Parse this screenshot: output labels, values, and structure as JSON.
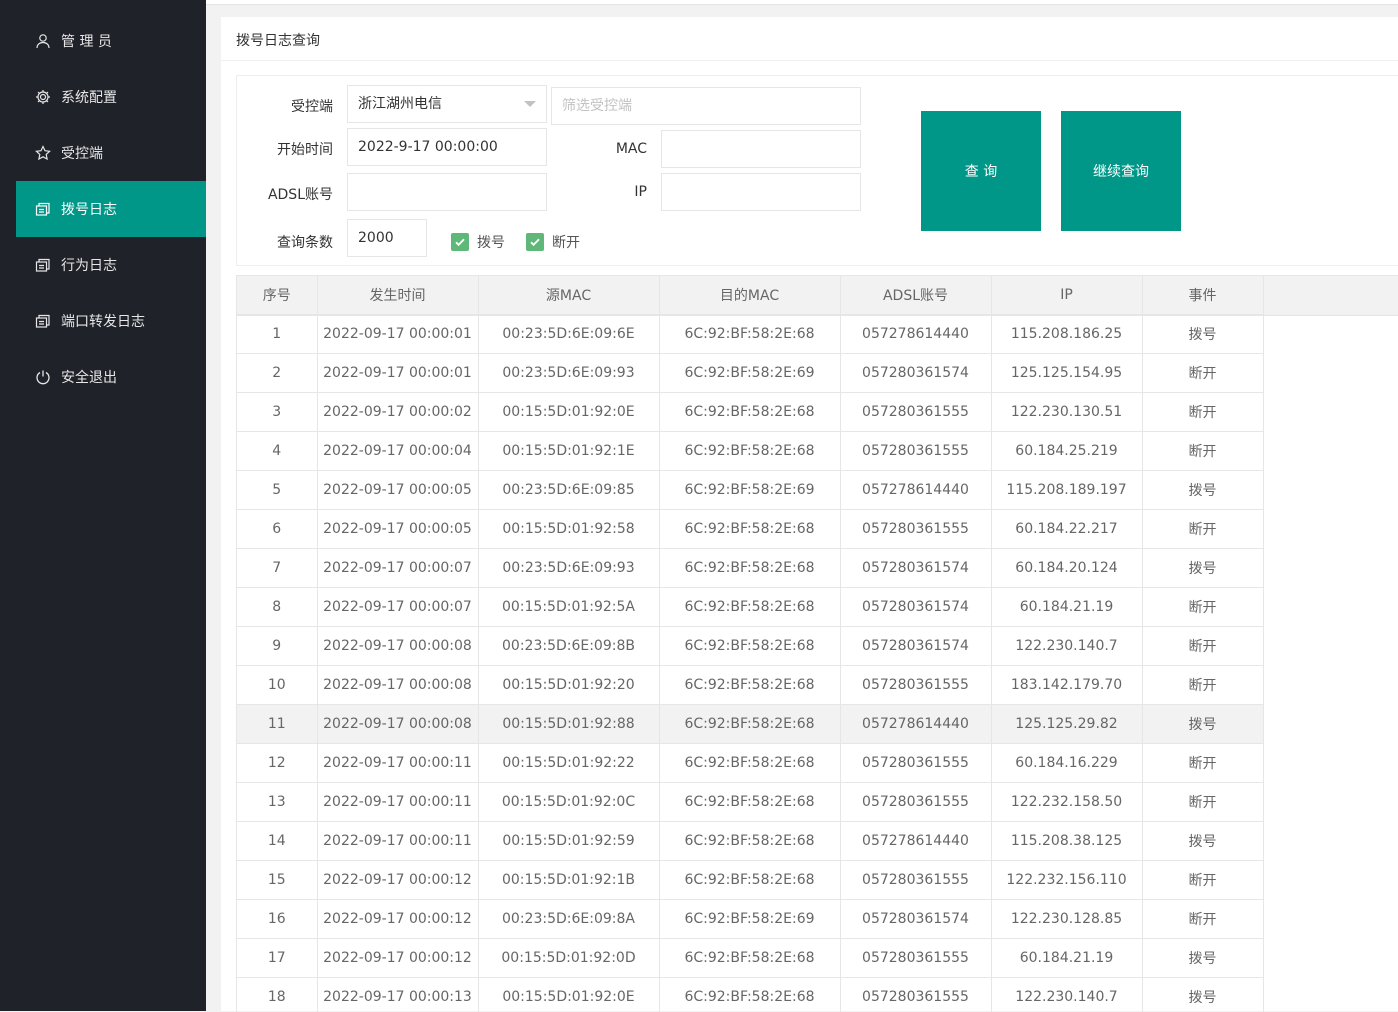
{
  "sidebar": {
    "items": [
      {
        "label": "管 理 员",
        "icon": "user-icon",
        "active": false
      },
      {
        "label": "系统配置",
        "icon": "gear-icon",
        "active": false
      },
      {
        "label": "受控端",
        "icon": "star-icon",
        "active": false
      },
      {
        "label": "拨号日志",
        "icon": "log-icon",
        "active": true
      },
      {
        "label": "行为日志",
        "icon": "log-icon",
        "active": false
      },
      {
        "label": "端口转发日志",
        "icon": "log-icon",
        "active": false
      },
      {
        "label": "安全退出",
        "icon": "power-icon",
        "active": false
      }
    ]
  },
  "panel": {
    "title": "拨号日志查询"
  },
  "form": {
    "controlled_label": "受控端",
    "controlled_value": "浙江湖州电信",
    "filter_placeholder": "筛选受控端",
    "start_label": "开始时间",
    "start_value": "2022-9-17 00:00:00",
    "mac_label": "MAC",
    "mac_value": "",
    "adsl_label": "ADSL账号",
    "adsl_value": "",
    "ip_label": "IP",
    "ip_value": "",
    "count_label": "查询条数",
    "count_value": "2000",
    "dial_label": "拨号",
    "dial_checked": true,
    "disconnect_label": "断开",
    "disconnect_checked": true,
    "query_button": "查 询",
    "continue_button": "继续查询"
  },
  "colors": {
    "accent": "#009688",
    "sidebar_bg": "#20222a",
    "checkbox": "#5fb878"
  },
  "table": {
    "headers": [
      "序号",
      "发生时间",
      "源MAC",
      "目的MAC",
      "ADSL账号",
      "IP",
      "事件"
    ],
    "highlight_row": 11,
    "rows": [
      [
        "1",
        "2022-09-17 00:00:01",
        "00:23:5D:6E:09:6E",
        "6C:92:BF:58:2E:68",
        "057278614440",
        "115.208.186.25",
        "拨号"
      ],
      [
        "2",
        "2022-09-17 00:00:01",
        "00:23:5D:6E:09:93",
        "6C:92:BF:58:2E:69",
        "057280361574",
        "125.125.154.95",
        "断开"
      ],
      [
        "3",
        "2022-09-17 00:00:02",
        "00:15:5D:01:92:0E",
        "6C:92:BF:58:2E:68",
        "057280361555",
        "122.230.130.51",
        "断开"
      ],
      [
        "4",
        "2022-09-17 00:00:04",
        "00:15:5D:01:92:1E",
        "6C:92:BF:58:2E:68",
        "057280361555",
        "60.184.25.219",
        "断开"
      ],
      [
        "5",
        "2022-09-17 00:00:05",
        "00:23:5D:6E:09:85",
        "6C:92:BF:58:2E:69",
        "057278614440",
        "115.208.189.197",
        "拨号"
      ],
      [
        "6",
        "2022-09-17 00:00:05",
        "00:15:5D:01:92:58",
        "6C:92:BF:58:2E:68",
        "057280361555",
        "60.184.22.217",
        "断开"
      ],
      [
        "7",
        "2022-09-17 00:00:07",
        "00:23:5D:6E:09:93",
        "6C:92:BF:58:2E:68",
        "057280361574",
        "60.184.20.124",
        "拨号"
      ],
      [
        "8",
        "2022-09-17 00:00:07",
        "00:15:5D:01:92:5A",
        "6C:92:BF:58:2E:68",
        "057280361574",
        "60.184.21.19",
        "断开"
      ],
      [
        "9",
        "2022-09-17 00:00:08",
        "00:23:5D:6E:09:8B",
        "6C:92:BF:58:2E:68",
        "057280361574",
        "122.230.140.7",
        "断开"
      ],
      [
        "10",
        "2022-09-17 00:00:08",
        "00:15:5D:01:92:20",
        "6C:92:BF:58:2E:68",
        "057280361555",
        "183.142.179.70",
        "断开"
      ],
      [
        "11",
        "2022-09-17 00:00:08",
        "00:15:5D:01:92:88",
        "6C:92:BF:58:2E:68",
        "057278614440",
        "125.125.29.82",
        "拨号"
      ],
      [
        "12",
        "2022-09-17 00:00:11",
        "00:15:5D:01:92:22",
        "6C:92:BF:58:2E:68",
        "057280361555",
        "60.184.16.229",
        "断开"
      ],
      [
        "13",
        "2022-09-17 00:00:11",
        "00:15:5D:01:92:0C",
        "6C:92:BF:58:2E:68",
        "057280361555",
        "122.232.158.50",
        "断开"
      ],
      [
        "14",
        "2022-09-17 00:00:11",
        "00:15:5D:01:92:59",
        "6C:92:BF:58:2E:68",
        "057278614440",
        "115.208.38.125",
        "拨号"
      ],
      [
        "15",
        "2022-09-17 00:00:12",
        "00:15:5D:01:92:1B",
        "6C:92:BF:58:2E:68",
        "057280361555",
        "122.232.156.110",
        "断开"
      ],
      [
        "16",
        "2022-09-17 00:00:12",
        "00:23:5D:6E:09:8A",
        "6C:92:BF:58:2E:69",
        "057280361574",
        "122.230.128.85",
        "断开"
      ],
      [
        "17",
        "2022-09-17 00:00:12",
        "00:15:5D:01:92:0D",
        "6C:92:BF:58:2E:68",
        "057280361555",
        "60.184.21.19",
        "拨号"
      ],
      [
        "18",
        "2022-09-17 00:00:13",
        "00:15:5D:01:92:0E",
        "6C:92:BF:58:2E:68",
        "057280361555",
        "122.230.140.7",
        "拨号"
      ]
    ]
  }
}
